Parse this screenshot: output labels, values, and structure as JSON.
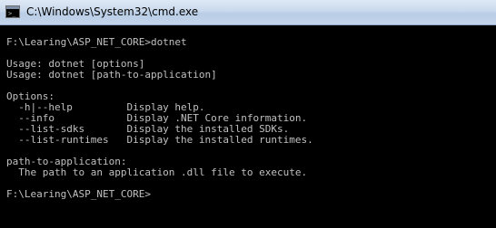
{
  "window": {
    "title": "C:\\Windows\\System32\\cmd.exe",
    "icon": "cmd-console-icon",
    "icon_glyph": ">_"
  },
  "console": {
    "text_color": "#c0c0c0",
    "background": "#000000",
    "lines": [
      "F:\\Learing\\ASP_NET_CORE>dotnet",
      "Usage: dotnet [options]",
      "Usage: dotnet [path-to-application]",
      "Options:",
      "  -h|--help         Display help.",
      "  --info            Display .NET Core information.",
      "  --list-sdks       Display the installed SDKs.",
      "  --list-runtimes   Display the installed runtimes.",
      "path-to-application:",
      "  The path to an application .dll file to execute.",
      "F:\\Learing\\ASP_NET_CORE>"
    ]
  }
}
